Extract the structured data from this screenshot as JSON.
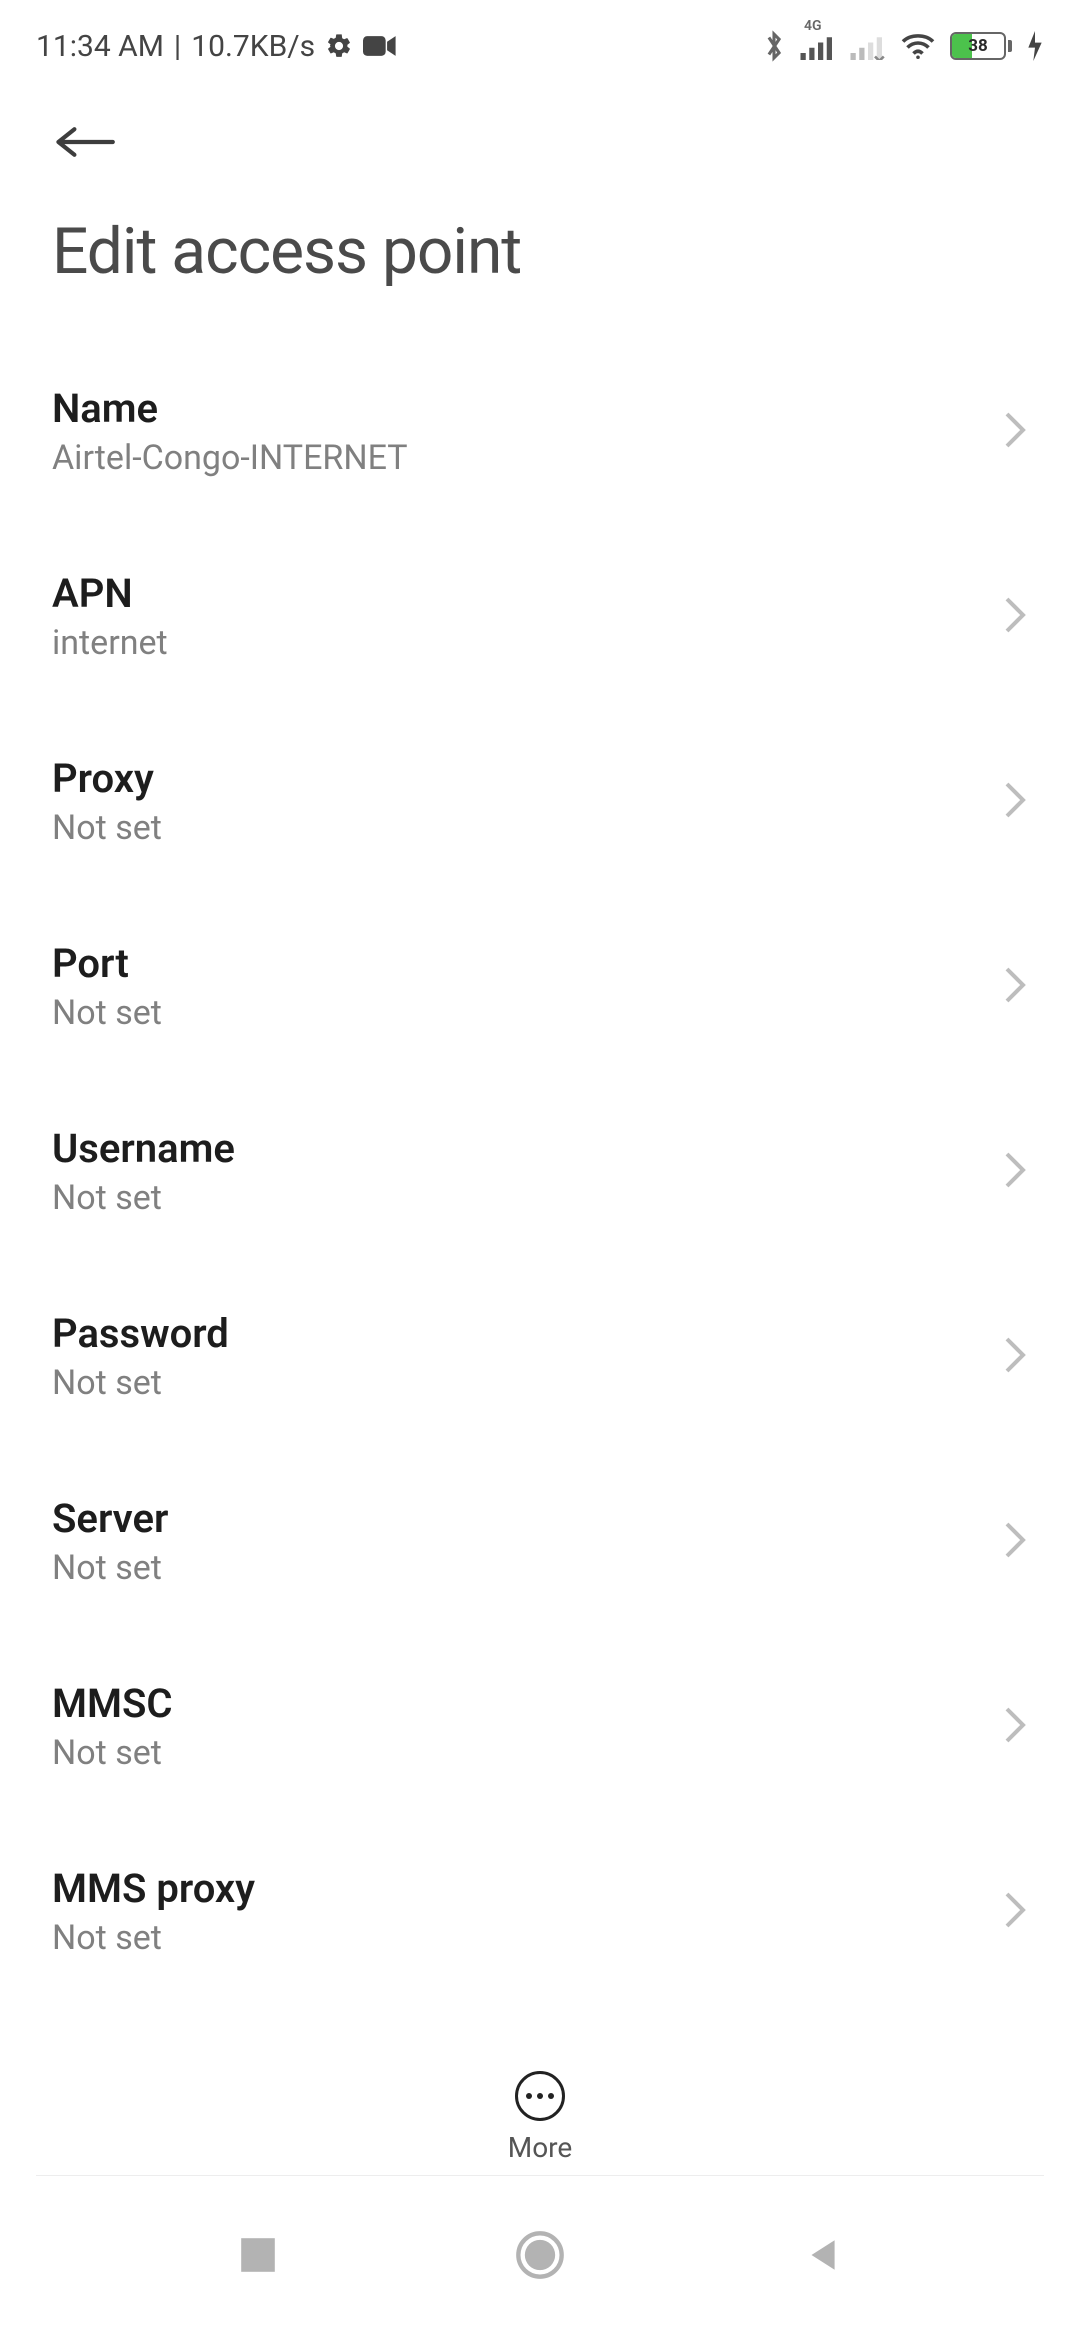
{
  "status_bar": {
    "time": "11:34 AM",
    "separator": "|",
    "data_rate": "10.7KB/s",
    "network_badge": "4G",
    "battery_pct": "38"
  },
  "header": {
    "title": "Edit access point"
  },
  "fields": [
    {
      "key": "name",
      "label": "Name",
      "value": "Airtel-Congo-INTERNET"
    },
    {
      "key": "apn",
      "label": "APN",
      "value": "internet"
    },
    {
      "key": "proxy",
      "label": "Proxy",
      "value": "Not set"
    },
    {
      "key": "port",
      "label": "Port",
      "value": "Not set"
    },
    {
      "key": "username",
      "label": "Username",
      "value": "Not set"
    },
    {
      "key": "password",
      "label": "Password",
      "value": "Not set"
    },
    {
      "key": "server",
      "label": "Server",
      "value": "Not set"
    },
    {
      "key": "mmsc",
      "label": "MMSC",
      "value": "Not set"
    },
    {
      "key": "mms_proxy",
      "label": "MMS proxy",
      "value": "Not set"
    }
  ],
  "footer": {
    "more_label": "More"
  }
}
